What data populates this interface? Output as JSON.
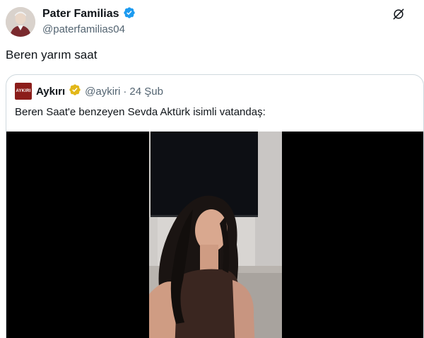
{
  "tweet": {
    "author_name": "Pater Familias",
    "author_handle": "@paterfamilias04",
    "text": "Beren yarım saat"
  },
  "quote": {
    "author_name": "Aykırı",
    "author_handle": "@aykiri",
    "separator": "·",
    "date": "24 Şub",
    "text": "Beren Saat'e benzeyen Sevda Aktürk isimli vatandaş:",
    "avatar_logo_text": "AYKIRI"
  },
  "colors": {
    "verified_blue": "#1d9bf0",
    "verified_gold": "#e2b719",
    "quote_avatar_bg": "#8b1d1a",
    "media_bg": "#000000"
  },
  "icons": {
    "verified": "verified-badge-icon",
    "grok": "grok-icon"
  }
}
